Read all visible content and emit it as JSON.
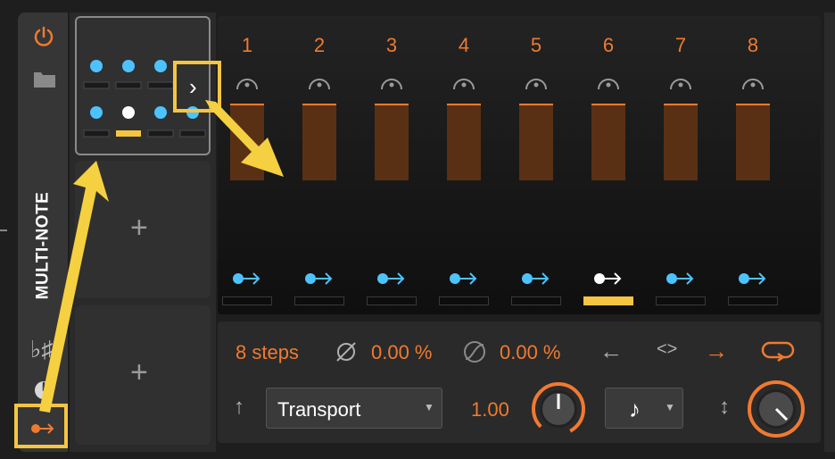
{
  "sidebar": {
    "device_label": "MULTI-NOTE",
    "icons": [
      "power-icon",
      "folder-icon",
      "flat-sharp-icon",
      "timer-icon",
      "note-route-icon"
    ]
  },
  "slots": {
    "add_label_1": "+",
    "add_label_2": "+"
  },
  "sequencer": {
    "columns": [
      "1",
      "2",
      "3",
      "4",
      "5",
      "6",
      "7",
      "8"
    ],
    "active_step": 6
  },
  "bottom": {
    "steps_label": "8 steps",
    "phase_value": "0.00 %",
    "skew_value": "0.00 %",
    "direction_left": "←",
    "direction_bounce": "<>",
    "direction_right": "→",
    "transport_label": "Transport",
    "rate_value": "1.00",
    "up_arrow": "↑",
    "vert_arrow": "↕"
  },
  "colors": {
    "accent": "#f07a30",
    "highlight": "#f5c542",
    "blue": "#4cc3ff",
    "bar": "#5a3015"
  }
}
